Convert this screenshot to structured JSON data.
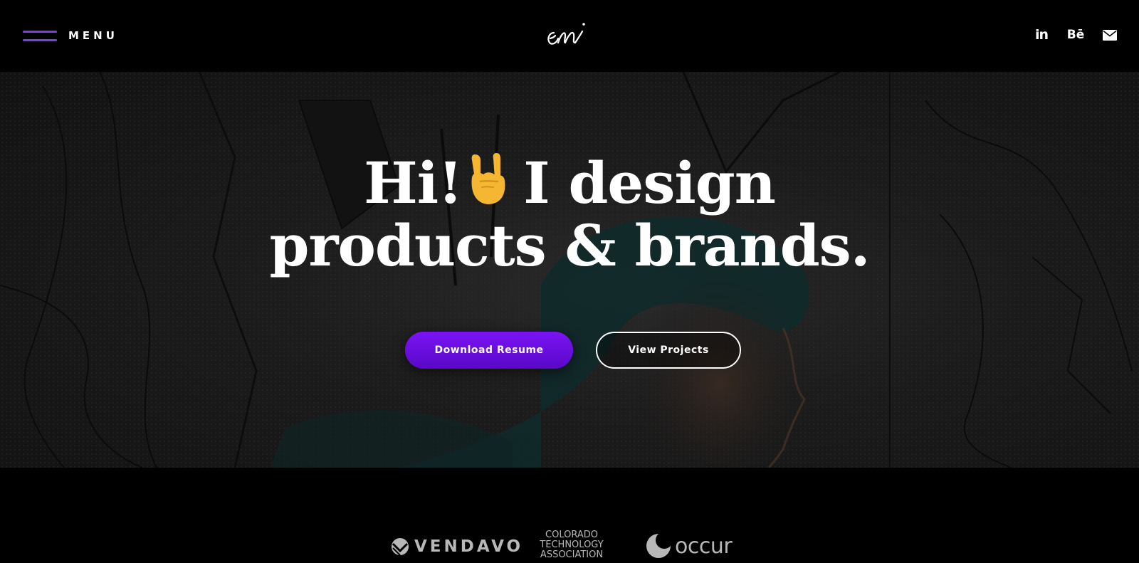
{
  "header": {
    "menu_label": "MENU",
    "logo_text": "em",
    "socials": [
      {
        "name": "linkedin-icon",
        "label": "in"
      },
      {
        "name": "behance-icon",
        "label": "Bē"
      },
      {
        "name": "mail-icon",
        "label": ""
      }
    ]
  },
  "hero": {
    "title_line1_a": "Hi!",
    "title_line1_b": "I design",
    "title_line2": "products & brands.",
    "emoji": "rock-on-hand-emoji",
    "primary_button": "Download Resume",
    "secondary_button": "View Projects"
  },
  "clients": {
    "logos": [
      "VENDAVO",
      "COLORADO TECHNOLOGY ASSOCIATION",
      "occur"
    ],
    "vendavo": "VENDAVO",
    "cta_line1": "COLORADO",
    "cta_line2": "TECHNOLOGY",
    "cta_line3": "ASSOCIATION",
    "occur": "occur"
  },
  "colors": {
    "accent": "#7b3fe4",
    "button_gradient_top": "#7a14f5",
    "button_gradient_bottom": "#5a08c8",
    "background": "#000000"
  }
}
